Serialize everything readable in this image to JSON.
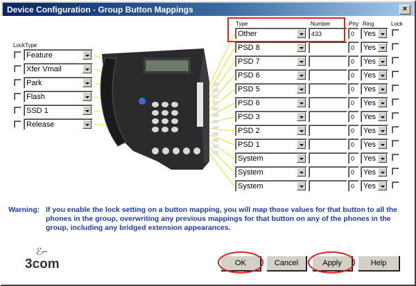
{
  "window": {
    "title": "Device Configuration - Group Button Mappings",
    "close_glyph": "×"
  },
  "left_headers": {
    "lock": "Lock",
    "type": "Type"
  },
  "left_buttons": [
    {
      "type": "Feature"
    },
    {
      "type": "Xfer Vmail"
    },
    {
      "type": "Park"
    },
    {
      "type": "Flash"
    },
    {
      "type": "SSD 1"
    },
    {
      "type": "Release"
    }
  ],
  "right_headers": {
    "type": "Type",
    "number": "Number",
    "prty": "Prty",
    "ring": "Ring",
    "lock": "Lock"
  },
  "right_buttons": [
    {
      "type": "Other",
      "number": "433",
      "prty": "0",
      "ring": "Yes"
    },
    {
      "type": "PSD 8",
      "number": "",
      "prty": "0",
      "ring": "Yes"
    },
    {
      "type": "PSD 7",
      "number": "",
      "prty": "0",
      "ring": "Yes"
    },
    {
      "type": "PSD 6",
      "number": "",
      "prty": "0",
      "ring": "Yes"
    },
    {
      "type": "PSD 5",
      "number": "",
      "prty": "0",
      "ring": "Yes"
    },
    {
      "type": "PSD 6",
      "number": "",
      "prty": "0",
      "ring": "Yes"
    },
    {
      "type": "PSD 3",
      "number": "",
      "prty": "0",
      "ring": "Yes"
    },
    {
      "type": "PSD 2",
      "number": "",
      "prty": "0",
      "ring": "Yes"
    },
    {
      "type": "PSD 1",
      "number": "",
      "prty": "0",
      "ring": "Yes"
    },
    {
      "type": "System",
      "number": "",
      "prty": "0",
      "ring": "Yes"
    },
    {
      "type": "System",
      "number": "",
      "prty": "0",
      "ring": "Yes"
    },
    {
      "type": "System",
      "number": "",
      "prty": "0",
      "ring": "Yes"
    }
  ],
  "warning": {
    "label": "Warning:",
    "text": "If you enable the lock setting on a button mapping, you will map those values for that button to all the phones in the group, overwriting any previous mappings for that button on any of the phones in the group, including any bridged extension appearances."
  },
  "logo": {
    "text": "3com"
  },
  "buttons": {
    "ok": "OK",
    "cancel": "Cancel",
    "apply": "Apply",
    "help": "Help"
  },
  "colors": {
    "titlebar": "#0a246a",
    "warning_text": "#1f3aa0",
    "highlight": "#e02020",
    "leader_line": "#e8e84a"
  }
}
